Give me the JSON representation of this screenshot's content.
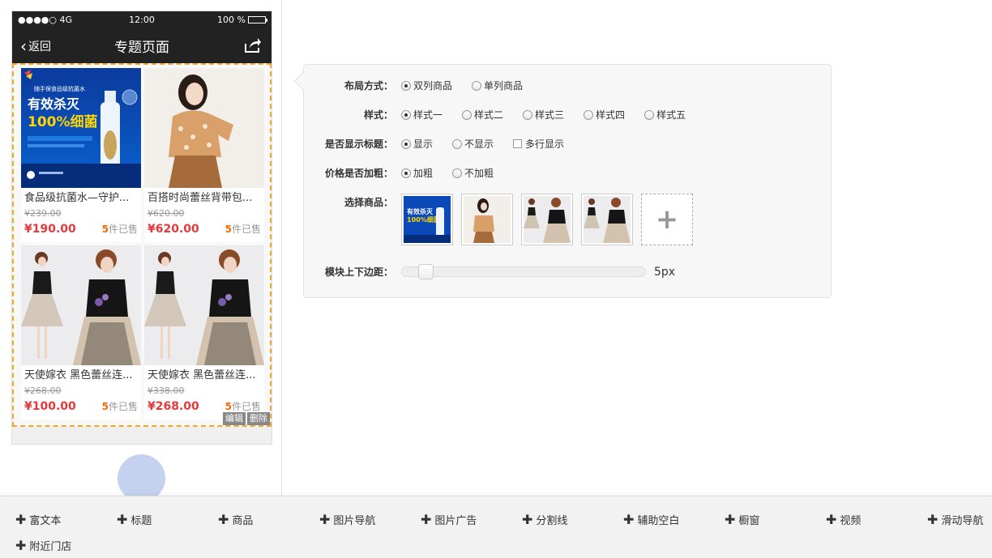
{
  "status_bar": {
    "signal": "●●●●○ 4G",
    "time": "12:00",
    "battery": "100 %"
  },
  "nav": {
    "back_label": "返回",
    "title": "专题页面"
  },
  "goods": [
    {
      "name": "食品级抗菌水—守护...",
      "orig_price": "¥239.00",
      "price": "¥190.00",
      "sold_count": "5",
      "sold_text": "件已售",
      "image": "ad-spray"
    },
    {
      "name": "百搭时尚蕾丝背带包...",
      "orig_price": "¥620.00",
      "price": "¥620.00",
      "sold_count": "5",
      "sold_text": "件已售",
      "image": "model-blouse"
    },
    {
      "name": "天使嫁衣 黑色蕾丝连...",
      "orig_price": "¥268.00",
      "price": "¥100.00",
      "sold_count": "5",
      "sold_text": "件已售",
      "image": "model-dress"
    },
    {
      "name": "天使嫁衣 黑色蕾丝连...",
      "orig_price": "¥338.00",
      "price": "¥268.00",
      "sold_count": "5",
      "sold_text": "件已售",
      "image": "model-dress"
    }
  ],
  "ad_text": {
    "brand": "随手保食品级抗菌水",
    "line1": "有效杀灭",
    "line2": "100%细菌",
    "thumb_line1": "有效杀灭",
    "thumb_line2": "100%细菌"
  },
  "edit_actions": {
    "edit": "编辑",
    "delete": "删除"
  },
  "settings": {
    "layout": {
      "label": "布局方式：",
      "options": [
        "双列商品",
        "单列商品"
      ],
      "selected": 0
    },
    "style": {
      "label": "样式：",
      "options": [
        "样式一",
        "样式二",
        "样式三",
        "样式四",
        "样式五"
      ],
      "selected": 0
    },
    "show_title": {
      "label": "是否显示标题：",
      "options": [
        "显示",
        "不显示"
      ],
      "selected": 0,
      "checkbox_label": "多行显示"
    },
    "bold_price": {
      "label": "价格是否加粗：",
      "options": [
        "加粗",
        "不加粗"
      ],
      "selected": 0
    },
    "select_goods": {
      "label": "选择商品：",
      "add_icon": "plus-icon"
    },
    "margin": {
      "label": "模块上下边距：",
      "value": "5px"
    }
  },
  "toolbar": {
    "items": [
      "富文本",
      "标题",
      "商品",
      "图片导航",
      "图片广告",
      "分割线",
      "辅助空白",
      "橱窗",
      "视频",
      "滑动导航",
      "附近门店"
    ]
  },
  "colors": {
    "accent_price": "#e4393c",
    "dashed_border": "#f5a623",
    "nav_bg": "#222222"
  }
}
